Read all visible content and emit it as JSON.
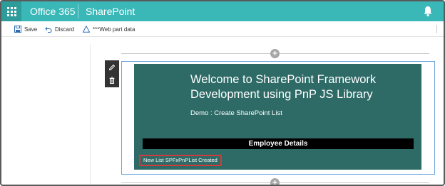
{
  "suite_bar": {
    "brand": "Office 365",
    "site": "SharePoint",
    "accent_color": "#3ab7b7"
  },
  "command_bar": {
    "save_label": "Save",
    "discard_label": "Discard",
    "web_part_data_label": "***Web part data"
  },
  "webpart": {
    "title": "Welcome to SharePoint Framework Development using PnP JS Library",
    "subtitle": "Demo : Create SharePoint List",
    "table_header": "Employee Details",
    "status": "New List SPFxPnPList Created",
    "background_color": "#2e6b67"
  },
  "icons": {
    "waffle": "app-launcher-icon",
    "bell": "bell-icon",
    "save": "save-icon",
    "discard": "undo-icon",
    "warning": "warning-icon",
    "edit": "pencil-icon",
    "delete": "trash-icon",
    "add": "plus-circle-icon"
  }
}
